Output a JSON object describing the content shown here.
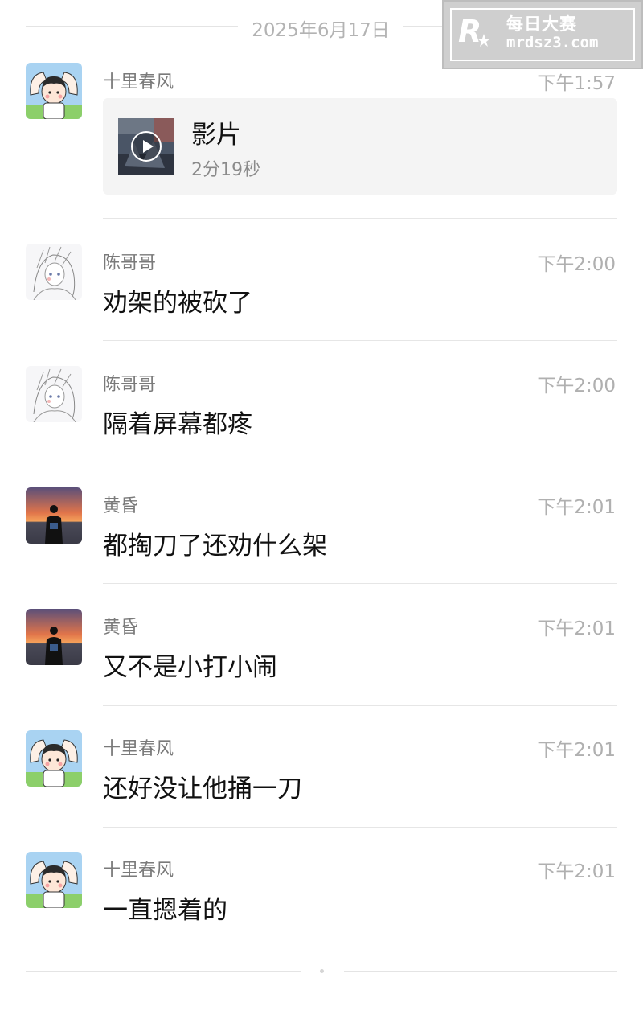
{
  "date_separator": "2025年6月17日",
  "watermark": {
    "name": "每日大赛",
    "url": "mrdsz3.com"
  },
  "colors": {
    "sender": "#7a7a7a",
    "time": "#b0b0b0",
    "card_bg": "#f4f4f4"
  },
  "messages": [
    {
      "sender": "十里春风",
      "time": "下午1:57",
      "avatar": "boy-heart-avatar",
      "type": "video",
      "video": {
        "title": "影片",
        "duration": "2分19秒",
        "icon": "play-icon"
      }
    },
    {
      "sender": "陈哥哥",
      "time": "下午2:00",
      "avatar": "anime-sketch-avatar",
      "text": "劝架的被砍了"
    },
    {
      "sender": "陈哥哥",
      "time": "下午2:00",
      "avatar": "anime-sketch-avatar",
      "text": "隔着屏幕都疼"
    },
    {
      "sender": "黄昏",
      "time": "下午2:01",
      "avatar": "sunset-silhouette-avatar",
      "text": "都掏刀了还劝什么架"
    },
    {
      "sender": "黄昏",
      "time": "下午2:01",
      "avatar": "sunset-silhouette-avatar",
      "text": "又不是小打小闹"
    },
    {
      "sender": "十里春风",
      "time": "下午2:01",
      "avatar": "boy-heart-avatar",
      "text": "还好没让他捅一刀"
    },
    {
      "sender": "十里春风",
      "time": "下午2:01",
      "avatar": "boy-heart-avatar",
      "text": "一直摁着的"
    }
  ]
}
